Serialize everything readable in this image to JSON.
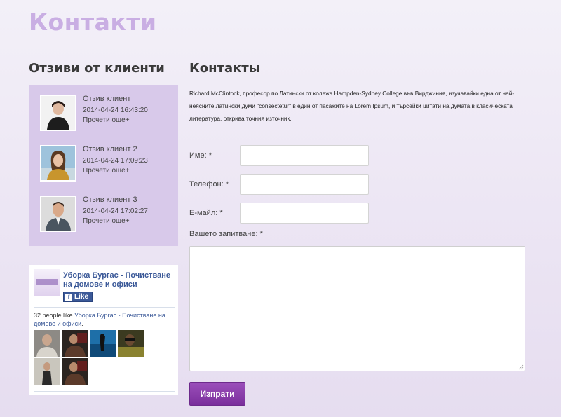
{
  "page": {
    "title": "Контакти"
  },
  "sidebar": {
    "heading": "Отзиви от клиенти",
    "testimonials": [
      {
        "title": "Отзив клиент",
        "date": "2014-04-24 16:43:20",
        "more": "Прочети още+"
      },
      {
        "title": "Отзив клиент 2",
        "date": "2014-04-24 17:09:23",
        "more": "Прочети още+"
      },
      {
        "title": "Отзив клиент 3",
        "date": "2014-04-24 17:02:27",
        "more": "Прочети още+"
      }
    ],
    "facebook": {
      "page_name": "Уборка Бургас - Почистване на домове и офиси",
      "like_label": "Like",
      "count_prefix": "32 people like ",
      "count_link": "Уборка Бургас - Почистване на домове и офиси",
      "count_suffix": "."
    }
  },
  "main": {
    "heading": "Контакты",
    "intro": "Richard McClintock, професор по Латински от колежа Hampden-Sydney College във Вирджиния, изучавайки една от най-неясните латински думи \"consectetur\" в един от пасажите на Lorem Ipsum, и търсейки цитати на думата в класическата литература, открива точния източник.",
    "form": {
      "name_label": "Име: *",
      "phone_label": "Телефон: *",
      "email_label": "E-майл: *",
      "inquiry_label": "Вашето запитване: *",
      "name_value": "",
      "phone_value": "",
      "email_value": "",
      "inquiry_value": "",
      "submit_label": "Изпрати"
    }
  },
  "colors": {
    "title": "#c9aee3",
    "testimonials_bg": "#d8c9ea",
    "button": "#8a3dad",
    "facebook": "#3b5998"
  }
}
